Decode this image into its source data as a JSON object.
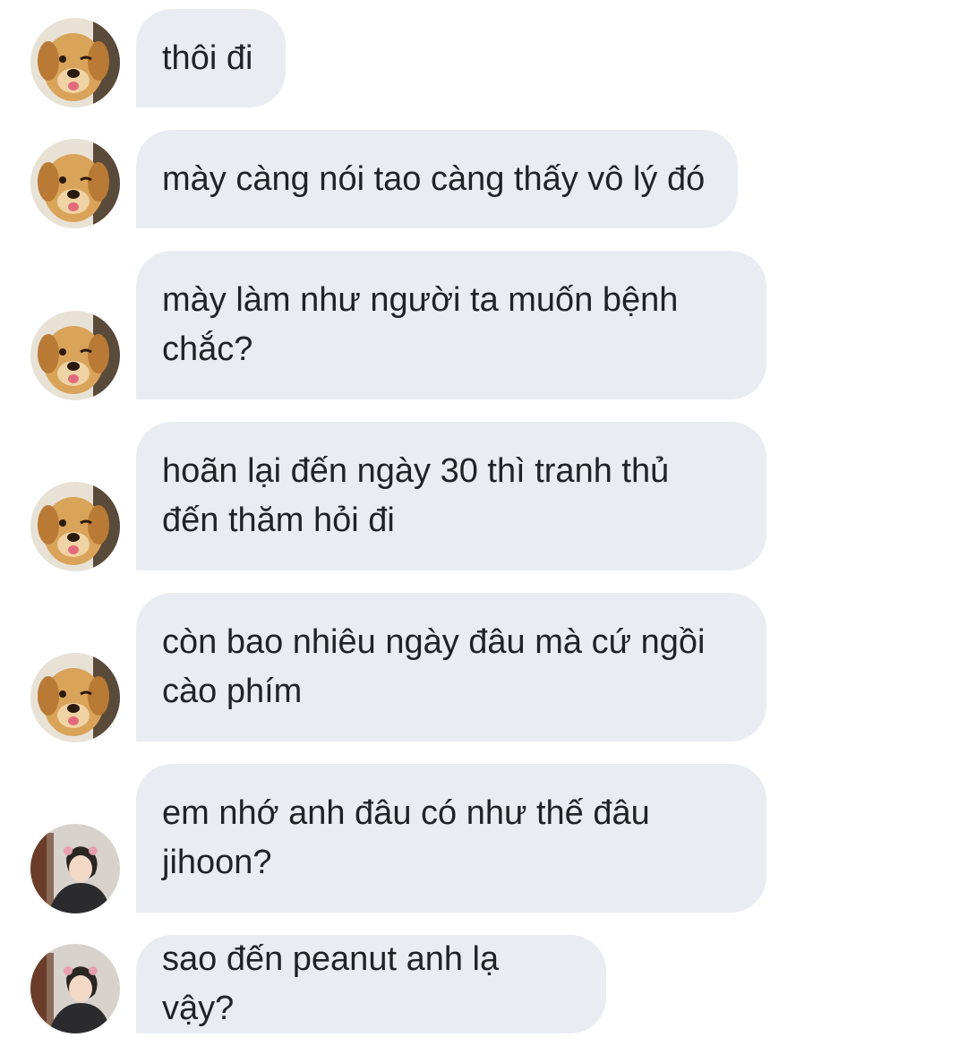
{
  "messages": [
    {
      "text": "thôi đi",
      "avatar": "dog-avatar-icon"
    },
    {
      "text": "mày càng nói tao càng thấy vô lý đó",
      "avatar": "dog-avatar-icon"
    },
    {
      "text": "mày làm như người ta muốn bệnh chắc?",
      "avatar": "dog-avatar-icon"
    },
    {
      "text": "hoãn lại đến ngày 30 thì tranh thủ đến thăm hỏi đi",
      "avatar": "dog-avatar-icon"
    },
    {
      "text": "còn bao nhiêu ngày đâu mà cứ ngồi cào phím",
      "avatar": "dog-avatar-icon"
    },
    {
      "text": "em nhớ anh đâu có như thế đâu jihoon?",
      "avatar": "person-avatar-icon"
    },
    {
      "text": "sao đến peanut anh lạ vậy?",
      "avatar": "person-avatar-icon"
    }
  ],
  "colors": {
    "bubble_bg": "#e9edf2",
    "text": "#1f2326"
  }
}
